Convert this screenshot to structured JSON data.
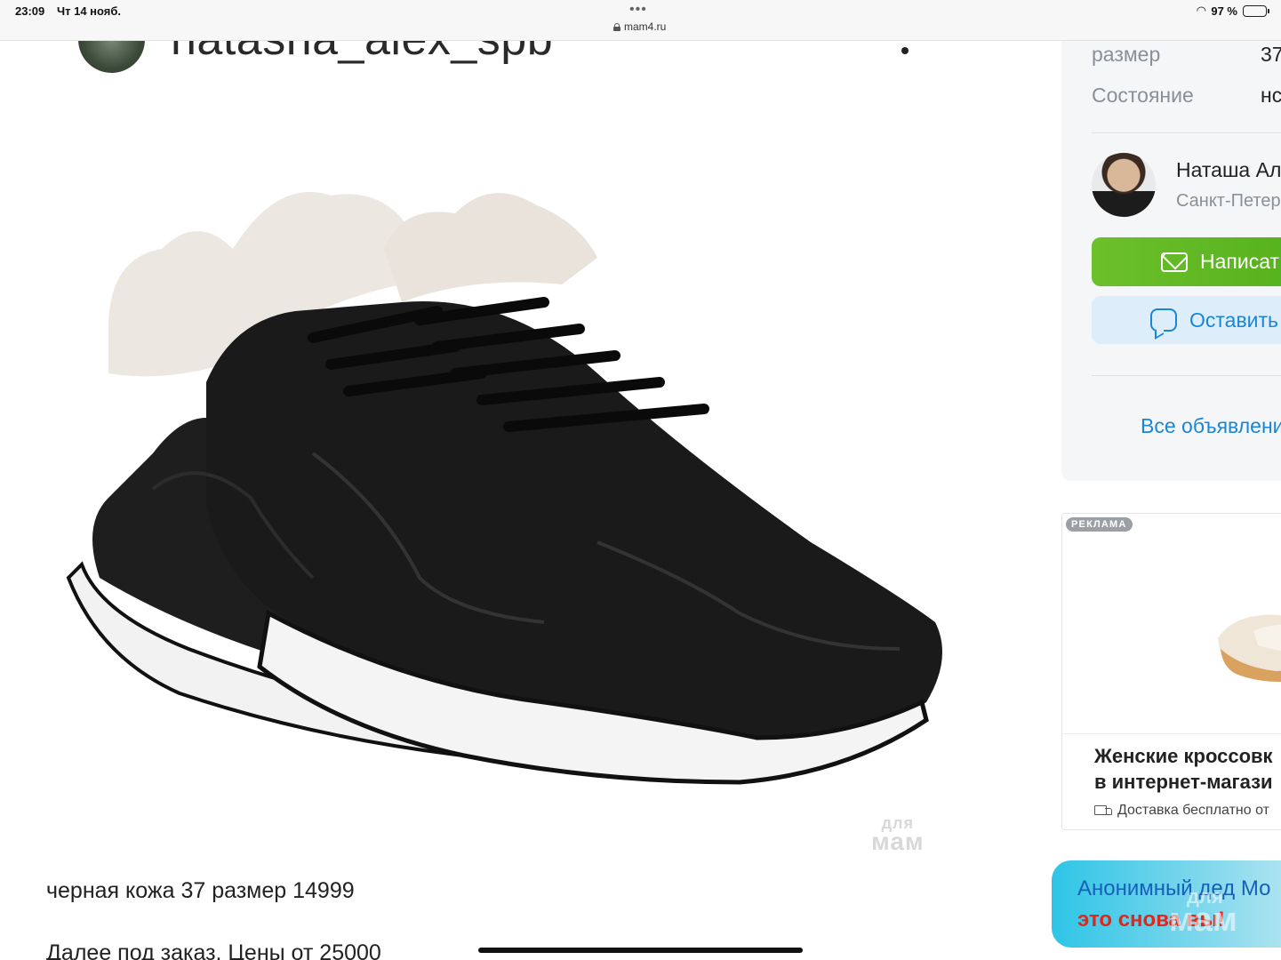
{
  "status_bar": {
    "time": "23:09",
    "date": "Чт 14 нояб.",
    "url": "mam4.ru",
    "battery": "97 %"
  },
  "post": {
    "username": "natasha_alex_spb",
    "description": "черная кожа 37 размер 14999",
    "description2": "Далее под заказ. Цены от 25000",
    "watermark_top": "для",
    "watermark_bottom": "мам"
  },
  "sidebar": {
    "properties": [
      {
        "label": "размер",
        "value": "37"
      },
      {
        "label": "Состояние",
        "value": "нс"
      }
    ],
    "seller": {
      "name": "Наташа Ал",
      "city": "Санкт-Петер"
    },
    "write_button": "Написат",
    "review_button": "Оставить",
    "all_ads_link": "Все объявлени"
  },
  "ad": {
    "badge": "РЕКЛАМА",
    "title_line1": "Женские кроссовк",
    "title_line2": "в интернет-магази",
    "delivery": "Доставка бесплатно от"
  },
  "promo": {
    "line1": "Анонимный дед Мо",
    "line2": "это снова вы!",
    "watermark_top": "для",
    "watermark_bottom": "мам"
  },
  "colors": {
    "green_button": "#5cb61f",
    "link_blue": "#1a86d6",
    "promo_red": "#e1261c"
  }
}
